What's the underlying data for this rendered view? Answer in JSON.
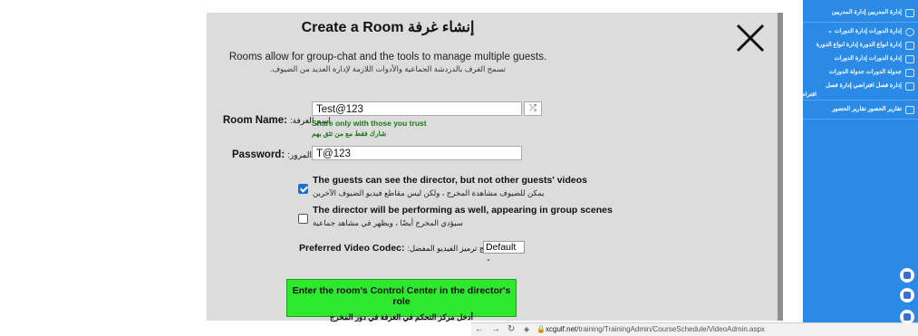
{
  "modal": {
    "title": "Create a Room إنشاء غرفة",
    "description_en": "Rooms allow for group-chat and the tools to manage multiple guests.",
    "description_ar": "تسمح الغرف بالدردشة الجماعية والأدوات اللازمة لإدارة العديد من الضيوف.",
    "room_name_label": "Room Name:",
    "room_name_label_ar": ":اسم الغرفة",
    "room_name_value": "Test@123",
    "share_hint_en": "Share only with those you trust",
    "share_hint_ar": "شارك فقط مع من تثق بهم",
    "password_label": "Password:",
    "password_label_ar": ":كلمة المرور",
    "password_value": "T@123",
    "option1_en": "The guests can see the director, but not other guests' videos",
    "option1_ar": "يمكن للضيوف مشاهدة المخرج ، ولكن ليس مقاطع فيديو الضيوف الآخرين",
    "option1_checked": true,
    "option2_en": "The director will be performing as well, appearing in group scenes",
    "option2_ar": "سيؤدي المخرج أيضًا ، ويظهر في مشاهد جماعية",
    "option2_checked": false,
    "codec_label": "Preferred Video Codec:",
    "codec_label_ar": ":برنامج ترميز الفيديو المفضل",
    "codec_value": "Default",
    "enter_button_en": "Enter the room's Control Center in the director's role",
    "enter_button_ar": "أدخل مركز التحكم في الغرفة في دور المخرج",
    "shuffle_icon": "shuffle-icon",
    "close_icon": "close-icon"
  },
  "browser": {
    "url_host": "xcgulf.net",
    "url_path": "/training/TrainingAdmin/CourseSchedule/VideoAdmin.aspx"
  },
  "sidebar": {
    "items": [
      {
        "label": "إدارة المدربين إدارة المدربين"
      },
      {
        "label": "إدارة الدورات إدارة الدورات ⌄"
      },
      {
        "label": "إدارة انواع الدورة إدارة انواع الدورة"
      },
      {
        "label": "إدارة الدورات إدارة الدورات"
      },
      {
        "label": "جدولة الدورات جدولة الدورات"
      },
      {
        "label": "إدارة فصل افتراضي إدارة فصل"
      },
      {
        "label": "افتراضي"
      },
      {
        "label": "تقارير الحضور تقارير الحضور"
      }
    ]
  },
  "colors": {
    "modal_bg": "#dcdcdc",
    "enter_button": "#2ee82e",
    "sidebar_bg": "#2a8ae6",
    "hint_green": "#1a7a1a",
    "checkbox_blue": "#1a6fd8"
  }
}
